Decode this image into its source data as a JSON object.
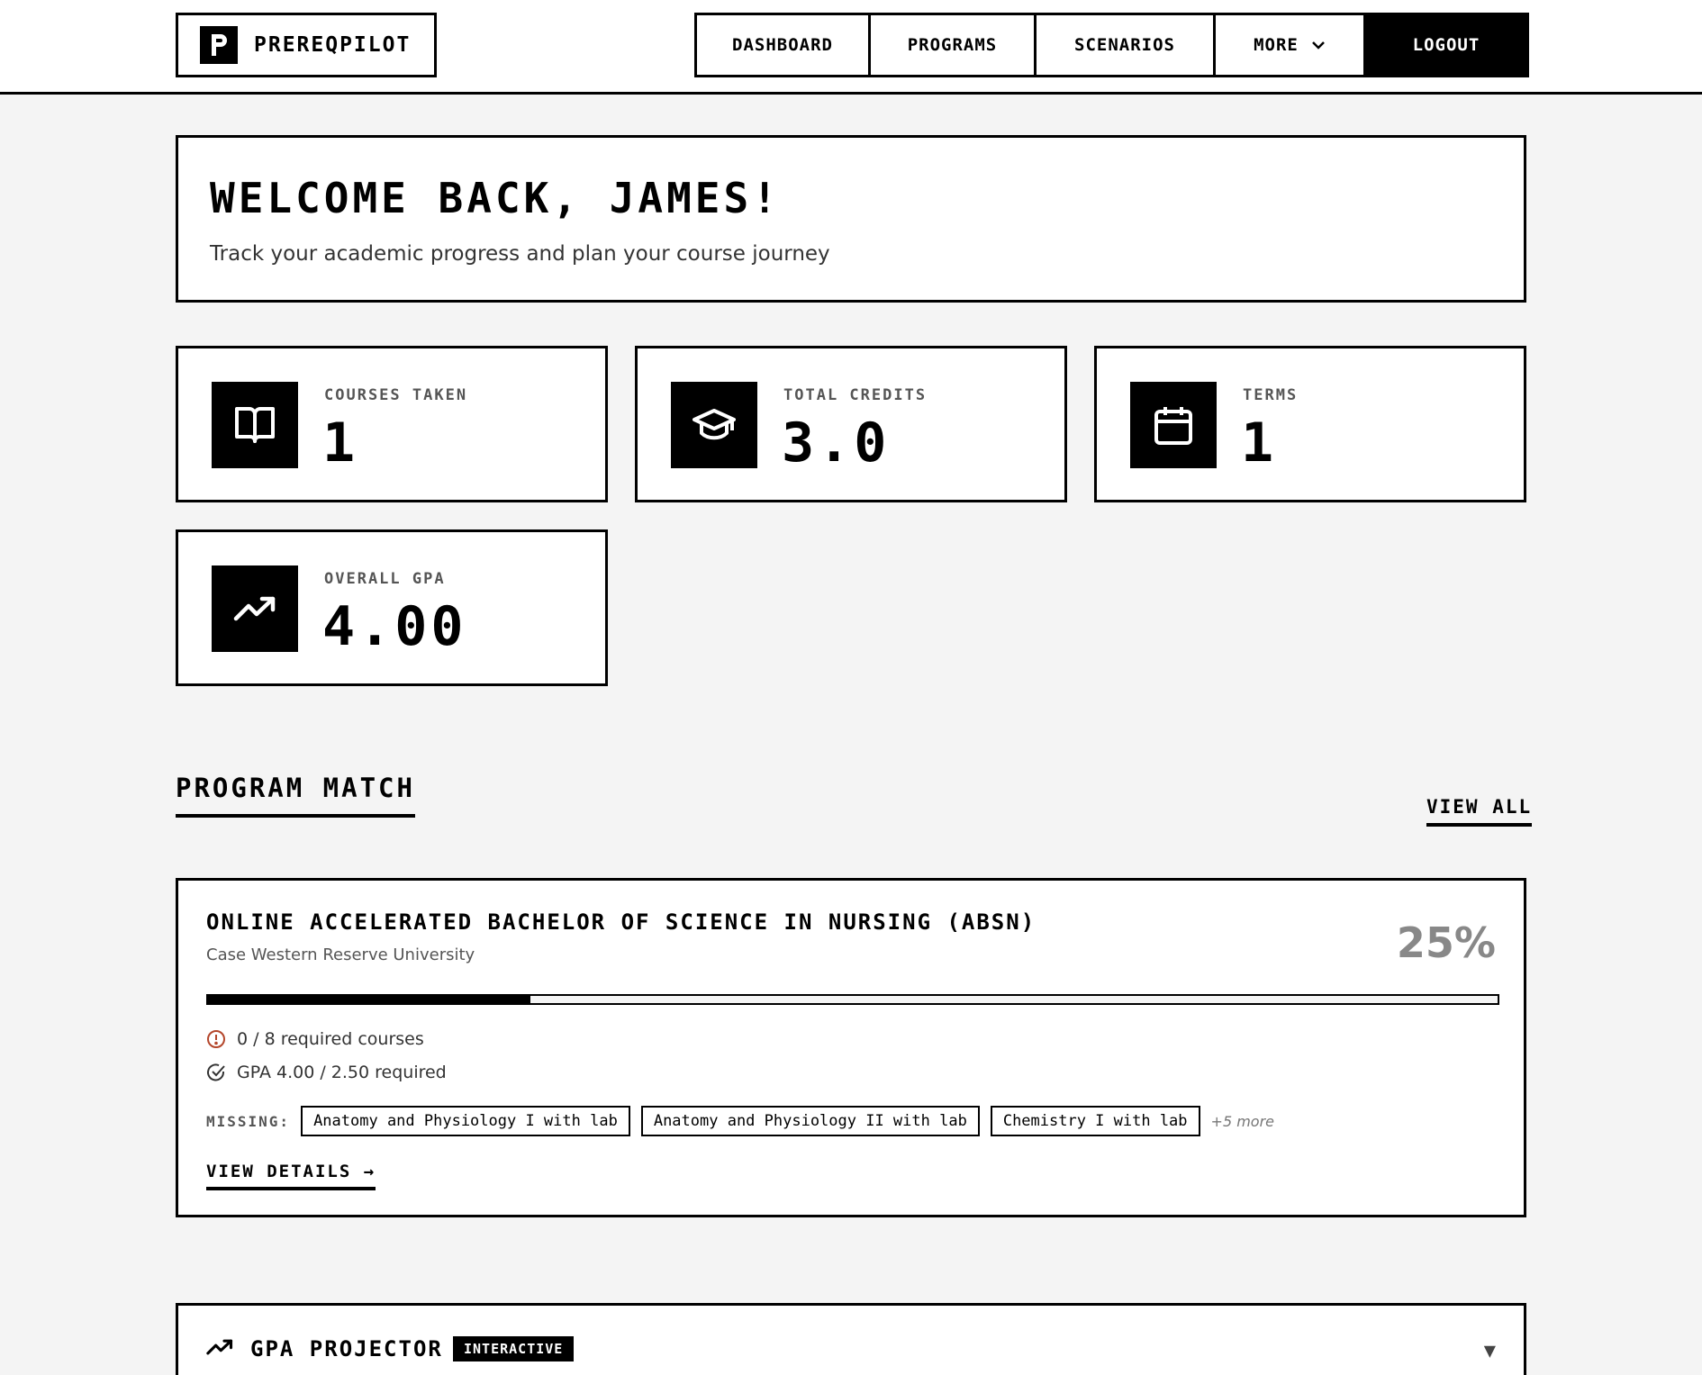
{
  "app": {
    "name": "PREREQPILOT",
    "logo_glyph": "P"
  },
  "nav": {
    "dashboard": "DASHBOARD",
    "programs": "PROGRAMS",
    "scenarios": "SCENARIOS",
    "more": "MORE",
    "logout": "LOGOUT"
  },
  "welcome": {
    "title": "WELCOME BACK, JAMES!",
    "subtitle": "Track your academic progress and plan your course journey"
  },
  "stats": [
    {
      "label": "COURSES TAKEN",
      "value": "1",
      "icon": "book-icon"
    },
    {
      "label": "TOTAL CREDITS",
      "value": "3.0",
      "icon": "graduation-cap-icon"
    },
    {
      "label": "TERMS",
      "value": "1",
      "icon": "calendar-icon"
    },
    {
      "label": "OVERALL GPA",
      "value": "4.00",
      "icon": "trending-up-icon"
    }
  ],
  "program_match": {
    "section_title": "PROGRAM MATCH",
    "view_all": "VIEW ALL",
    "program": {
      "title": "ONLINE ACCELERATED BACHELOR OF SCIENCE IN NURSING (ABSN)",
      "school": "Case Western Reserve University",
      "match_percent": "25%",
      "match_fraction": 0.25,
      "required_courses": "0 / 8 required courses",
      "gpa_requirement": "GPA 4.00 / 2.50 required",
      "missing_label": "MISSING:",
      "missing": [
        "Anatomy and Physiology I with lab",
        "Anatomy and Physiology II with lab",
        "Chemistry I with lab"
      ],
      "more_missing": "+5 more",
      "view_details": "VIEW DETAILS →"
    }
  },
  "gpa_projector": {
    "title": "GPA PROJECTOR",
    "badge": "INTERACTIVE",
    "toggle": "▼"
  },
  "colors": {
    "background": "#f4f4f4",
    "surface": "#ffffff",
    "ink": "#000000",
    "warning": "#b4462b",
    "muted": "#888888"
  }
}
